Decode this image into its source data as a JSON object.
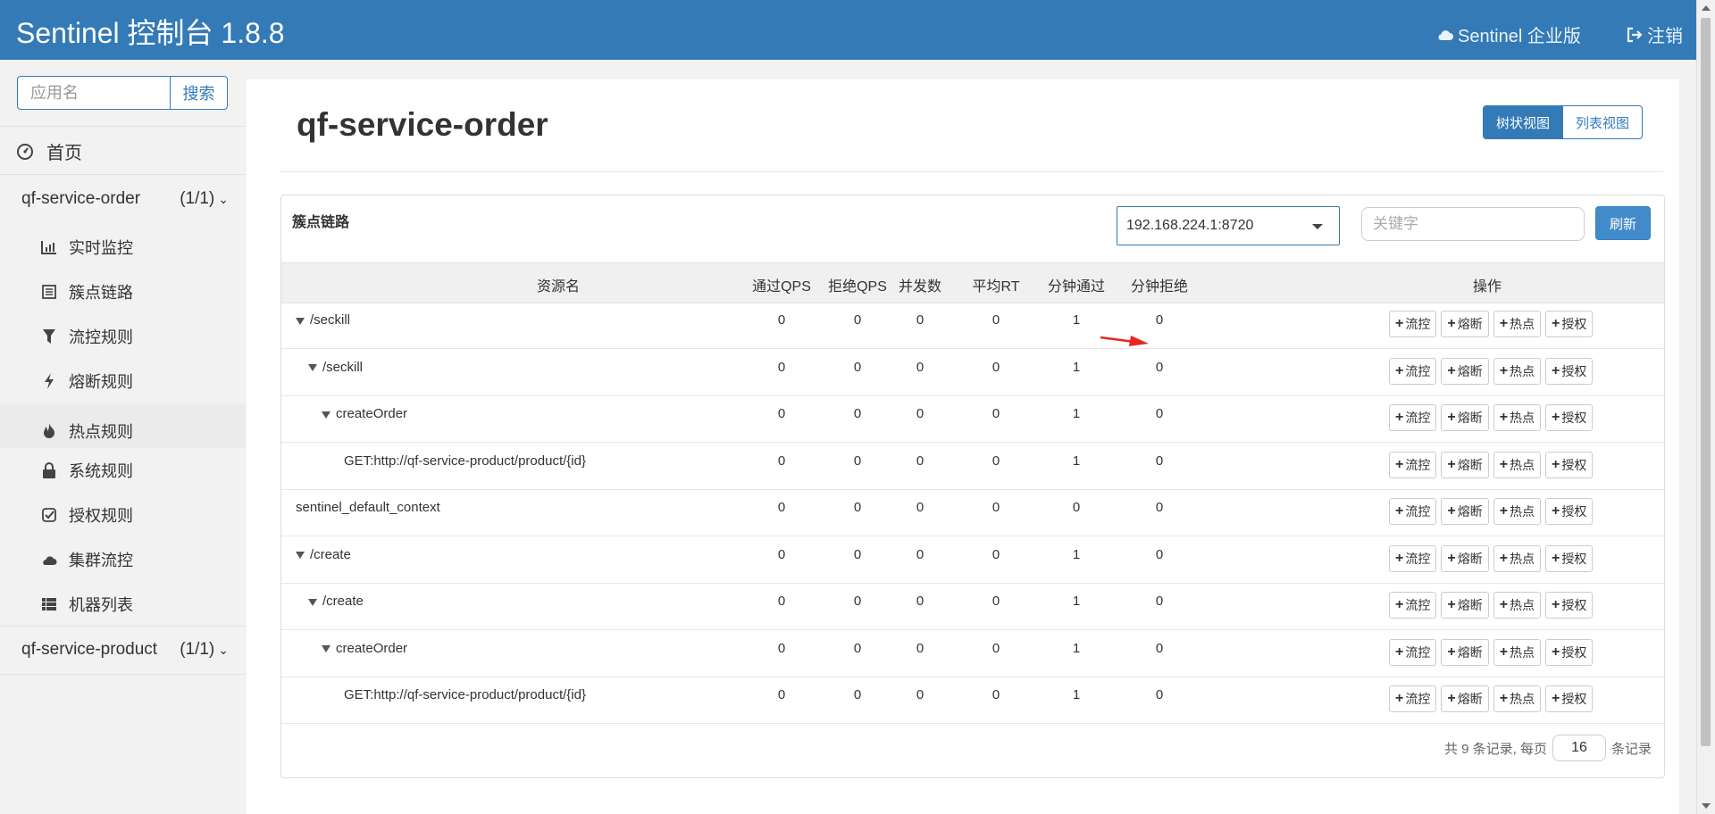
{
  "header": {
    "brand": "Sentinel 控制台 1.8.8",
    "enterprise_link": "Sentinel 企业版",
    "logout_link": "注销"
  },
  "sidebar": {
    "search_placeholder": "应用名",
    "search_button": "搜索",
    "home": "首页",
    "apps": [
      {
        "name": "qf-service-order",
        "count": "(1/1)"
      },
      {
        "name": "qf-service-product",
        "count": "(1/1)"
      }
    ],
    "menu": [
      {
        "label": "实时监控",
        "icon": "bar-chart-icon"
      },
      {
        "label": "簇点链路",
        "icon": "list-icon"
      },
      {
        "label": "流控规则",
        "icon": "filter-icon"
      },
      {
        "label": "熔断规则",
        "icon": "flash-icon"
      },
      {
        "label": "热点规则",
        "icon": "fire-icon"
      },
      {
        "label": "系统规则",
        "icon": "lock-icon"
      },
      {
        "label": "授权规则",
        "icon": "check-icon"
      },
      {
        "label": "集群流控",
        "icon": "cloud-icon"
      },
      {
        "label": "机器列表",
        "icon": "th-list-icon"
      }
    ]
  },
  "main": {
    "title": "qf-service-order",
    "view_tree": "树状视图",
    "view_list": "列表视图",
    "panel_title": "簇点链路",
    "machine": "192.168.224.1:8720",
    "keyword_placeholder": "关键字",
    "refresh": "刷新",
    "columns": [
      "资源名",
      "通过QPS",
      "拒绝QPS",
      "并发数",
      "平均RT",
      "分钟通过",
      "分钟拒绝",
      "操作"
    ],
    "op_labels": [
      "流控",
      "熔断",
      "热点",
      "授权"
    ],
    "rows": [
      {
        "name": "/seckill",
        "level": 0,
        "expand": true,
        "pass_qps": "0",
        "block_qps": "0",
        "threads": "0",
        "rt": "0",
        "min_pass": "1",
        "min_block": "0"
      },
      {
        "name": "/seckill",
        "level": 1,
        "expand": true,
        "pass_qps": "0",
        "block_qps": "0",
        "threads": "0",
        "rt": "0",
        "min_pass": "1",
        "min_block": "0"
      },
      {
        "name": "createOrder",
        "level": 2,
        "expand": true,
        "pass_qps": "0",
        "block_qps": "0",
        "threads": "0",
        "rt": "0",
        "min_pass": "1",
        "min_block": "0"
      },
      {
        "name": "GET:http://qf-service-product/product/{id}",
        "level": 3,
        "expand": false,
        "pass_qps": "0",
        "block_qps": "0",
        "threads": "0",
        "rt": "0",
        "min_pass": "1",
        "min_block": "0"
      },
      {
        "name": "sentinel_default_context",
        "level": 0,
        "expand": false,
        "pass_qps": "0",
        "block_qps": "0",
        "threads": "0",
        "rt": "0",
        "min_pass": "0",
        "min_block": "0"
      },
      {
        "name": "/create",
        "level": 0,
        "expand": true,
        "pass_qps": "0",
        "block_qps": "0",
        "threads": "0",
        "rt": "0",
        "min_pass": "1",
        "min_block": "0"
      },
      {
        "name": "/create",
        "level": 1,
        "expand": true,
        "pass_qps": "0",
        "block_qps": "0",
        "threads": "0",
        "rt": "0",
        "min_pass": "1",
        "min_block": "0"
      },
      {
        "name": "createOrder",
        "level": 2,
        "expand": true,
        "pass_qps": "0",
        "block_qps": "0",
        "threads": "0",
        "rt": "0",
        "min_pass": "1",
        "min_block": "0"
      },
      {
        "name": "GET:http://qf-service-product/product/{id}",
        "level": 3,
        "expand": false,
        "pass_qps": "0",
        "block_qps": "0",
        "threads": "0",
        "rt": "0",
        "min_pass": "1",
        "min_block": "0"
      }
    ],
    "pager_total": "共 9 条记录, 每页",
    "page_size": "16",
    "pager_suffix": "条记录"
  },
  "colors": {
    "header_bg": "#337ab7",
    "primary": "#428bca",
    "annotation_arrow": "#e8261f"
  }
}
